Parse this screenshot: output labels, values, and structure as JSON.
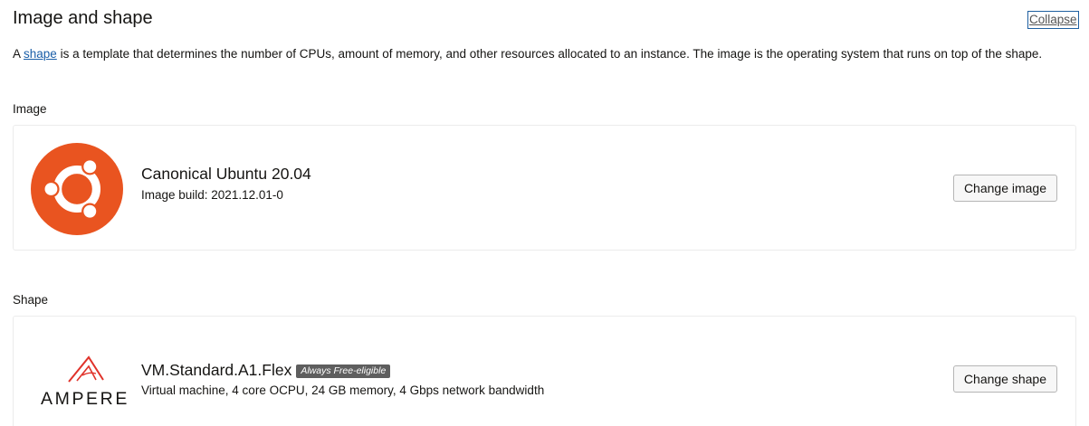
{
  "header": {
    "title": "Image and shape",
    "collapse_label": "Collapse"
  },
  "description": {
    "prefix": "A ",
    "link_text": "shape",
    "suffix": " is a template that determines the number of CPUs, amount of memory, and other resources allocated to an instance. The image is the operating system that runs on top of the shape."
  },
  "image_section": {
    "label": "Image",
    "name": "Canonical Ubuntu 20.04",
    "build": "Image build: 2021.12.01-0",
    "button_label": "Change image",
    "logo_icon": "ubuntu-logo-icon",
    "logo_color": "#e95420"
  },
  "shape_section": {
    "label": "Shape",
    "name": "VM.Standard.A1.Flex",
    "badge": "Always Free-eligible",
    "details": "Virtual machine, 4 core OCPU, 24 GB memory, 4 Gbps network bandwidth",
    "button_label": "Change shape",
    "logo_icon": "ampere-logo-icon",
    "logo_text": "AMPERE",
    "logo_color": "#e0322a"
  }
}
